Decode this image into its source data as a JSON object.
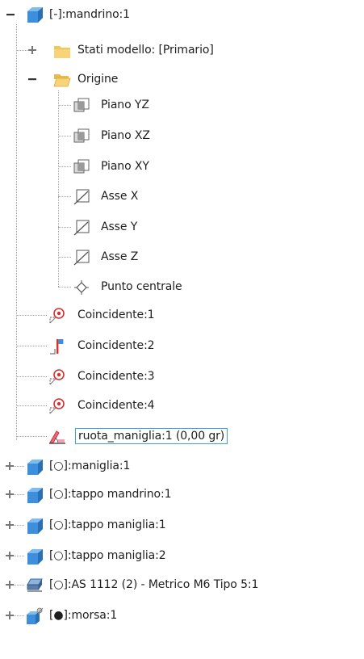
{
  "tree": {
    "root": {
      "label": "[-]:mandrino:1",
      "icon": "part-cube-icon",
      "state": "expanded"
    },
    "stati_modello": {
      "label": "Stati modello: [Primario]",
      "icon": "folder-icon",
      "state": "collapsed"
    },
    "origine": {
      "label": "Origine",
      "icon": "folder-open-icon",
      "state": "expanded"
    },
    "origine_items": [
      {
        "label": "Piano YZ",
        "icon": "work-plane-icon"
      },
      {
        "label": "Piano XZ",
        "icon": "work-plane-icon"
      },
      {
        "label": "Piano XY",
        "icon": "work-plane-icon"
      },
      {
        "label": "Asse X",
        "icon": "work-axis-icon"
      },
      {
        "label": "Asse Y",
        "icon": "work-axis-icon"
      },
      {
        "label": "Asse Z",
        "icon": "work-axis-icon"
      },
      {
        "label": "Punto centrale",
        "icon": "work-point-icon"
      }
    ],
    "constraints": [
      {
        "label": "Coincidente:1",
        "icon": "coincident-constraint-icon"
      },
      {
        "label": "Coincidente:2",
        "icon": "flush-constraint-icon"
      },
      {
        "label": "Coincidente:3",
        "icon": "coincident-constraint-icon"
      },
      {
        "label": "Coincidente:4",
        "icon": "coincident-constraint-icon"
      },
      {
        "label": "ruota_maniglia:1 (0,00 gr)",
        "icon": "angle-constraint-icon",
        "selected": true
      }
    ],
    "components": [
      {
        "label": "[○]:maniglia:1",
        "icon": "part-cube-icon"
      },
      {
        "label": "[○]:tappo mandrino:1",
        "icon": "part-cube-icon"
      },
      {
        "label": "[○]:tappo maniglia:1",
        "icon": "part-cube-icon"
      },
      {
        "label": "[○]:tappo maniglia:2",
        "icon": "part-cube-icon"
      },
      {
        "label": "[○]:AS 1112 (2) - Metrico M6  Tipo 5:1",
        "icon": "fastener-part-icon"
      },
      {
        "label": "[●]:morsa:1",
        "icon": "assembly-part-icon"
      }
    ]
  },
  "colors": {
    "cube_blue": "#3d8fdc",
    "folder_yellow": "#f3c65a",
    "selection_border": "#35a2e6",
    "constraint_red": "#d9302c",
    "tree_line": "#a0a0a0"
  }
}
